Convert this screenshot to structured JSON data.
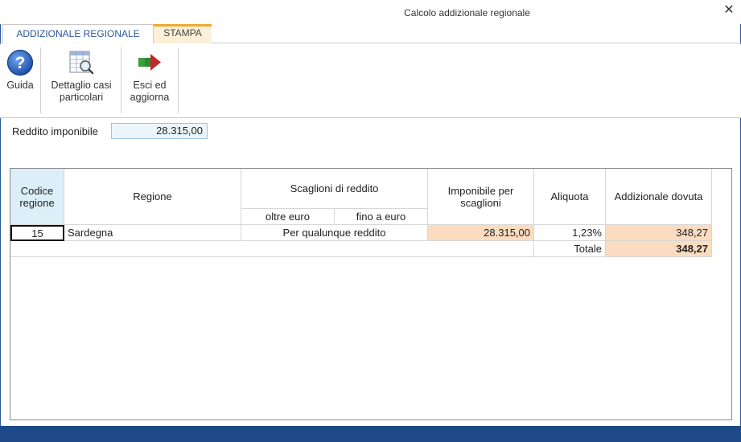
{
  "window": {
    "title": "Calcolo addizionale regionale",
    "close_glyph": "✕"
  },
  "tabs": [
    {
      "label": "ADDIZIONALE REGIONALE"
    },
    {
      "label": "STAMPA"
    }
  ],
  "ribbon": {
    "guida": "Guida",
    "dettaglio_line1": "Dettaglio casi",
    "dettaglio_line2": "particolari",
    "esci_line1": "Esci ed",
    "esci_line2": "aggiorna",
    "icons": [
      "question-icon",
      "table-magnifier-icon",
      "exit-arrow-icon"
    ]
  },
  "reddito": {
    "label": "Reddito imponibile",
    "value": "28.315,00"
  },
  "table": {
    "headers": {
      "codice_line1": "Codice",
      "codice_line2": "regione",
      "regione": "Regione",
      "scaglioni": "Scaglioni di reddito",
      "oltre": "oltre euro",
      "fino": "fino a euro",
      "imponibile_line1": "Imponibile per",
      "imponibile_line2": "scaglioni",
      "aliquota": "Aliquota",
      "addizionale": "Addizionale dovuta"
    },
    "rows": [
      {
        "codice": "15",
        "regione": "Sardegna",
        "scaglione": "Per qualunque reddito",
        "imponibile": "28.315,00",
        "aliquota": "1,23%",
        "addizionale": "348,27"
      }
    ],
    "totale_label": "Totale",
    "totale_value": "348,27"
  },
  "colors": {
    "accent": "#2b579a",
    "highlight_orange": "#fbdcc0",
    "input_bg": "#eaf6fb",
    "status_bar": "#1e4a8a"
  }
}
